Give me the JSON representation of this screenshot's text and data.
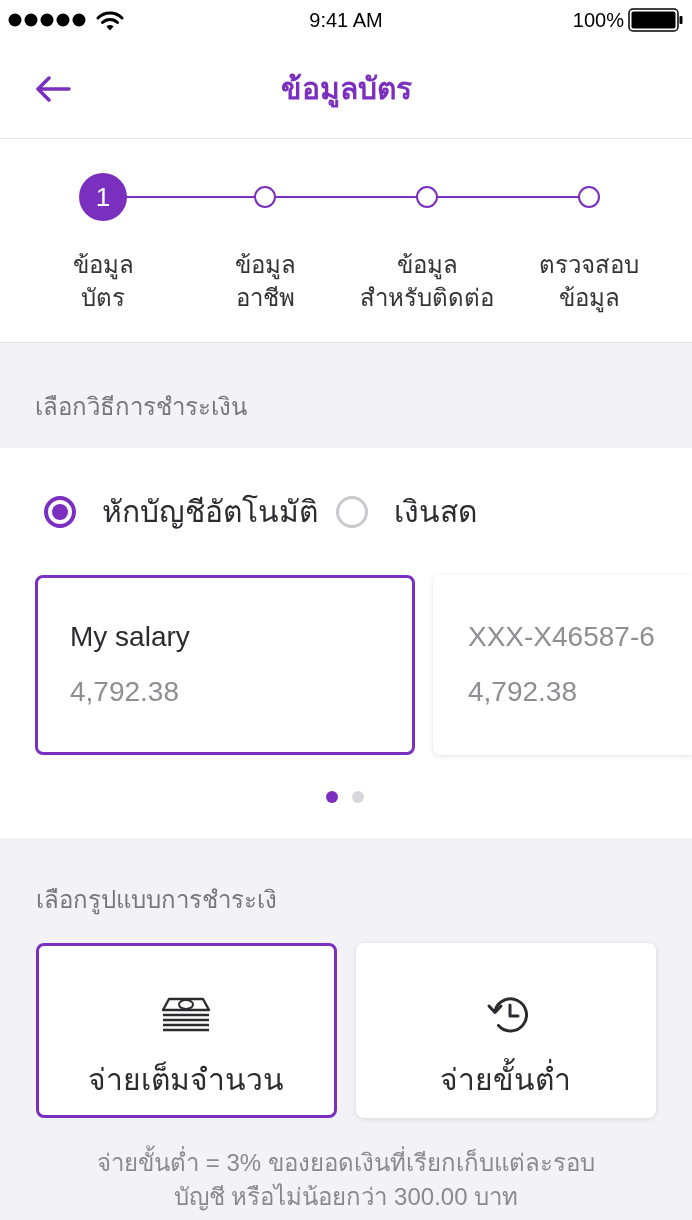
{
  "status_bar": {
    "time": "9:41 AM",
    "battery": "100%"
  },
  "nav_bar": {
    "title": "ข้อมูลบัตร"
  },
  "steps": [
    {
      "number": "1",
      "label": "ข้อมูล\nบัตร",
      "selected": true
    },
    {
      "label": "ข้อมูล\nอาชีพ",
      "selected": false
    },
    {
      "label": "ข้อมูล\nสำหรับติดต่อ",
      "selected": false
    },
    {
      "label": "ตรวจสอบ\nข้อมูล",
      "selected": false
    }
  ],
  "payment_method": {
    "heading": "เลือกวิธีการชำระเงิน",
    "options": [
      {
        "label": "หักบัญชีอัตโนมัติ",
        "selected": true
      },
      {
        "label": "เงินสด",
        "selected": false
      }
    ],
    "accounts": [
      {
        "name": "My salary",
        "balance": "4,792.38",
        "selected": true
      },
      {
        "name": "XXX-X46587-6",
        "balance": "4,792.38",
        "selected": false
      }
    ],
    "pages": [
      {
        "selected": true
      },
      {
        "selected": false
      }
    ]
  },
  "payment_type": {
    "heading": "เลือกรูปแบบการชำระเงิ",
    "options": [
      {
        "kind": "full",
        "label": "จ่ายเต็มจำนวน",
        "selected": true
      },
      {
        "kind": "minimum",
        "label": "จ่ายขั้นต่ำ",
        "selected": false
      }
    ],
    "note": "จ่ายขั้นต่ำ = 3% ของยอดเงินที่เรียกเก็บแต่ละรอบ\nบัญชี หรือไม่น้อยกว่า 300.00 บาท"
  }
}
